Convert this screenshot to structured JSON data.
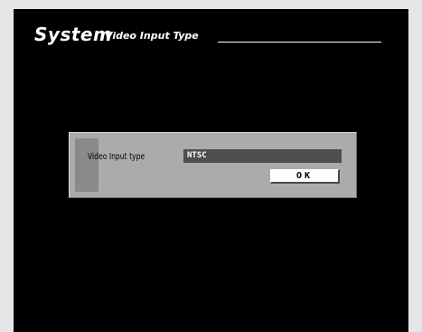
{
  "header": {
    "title": "System",
    "subtitle": "Video Input Type"
  },
  "dialog": {
    "field_label": "Video Input type",
    "field_value": "NTSC",
    "ok_label": "OK"
  },
  "colors": {
    "screen_background": "#000000",
    "dialog_background": "#ababab",
    "field_background": "#4f4f4f",
    "button_background": "#ffffff"
  }
}
